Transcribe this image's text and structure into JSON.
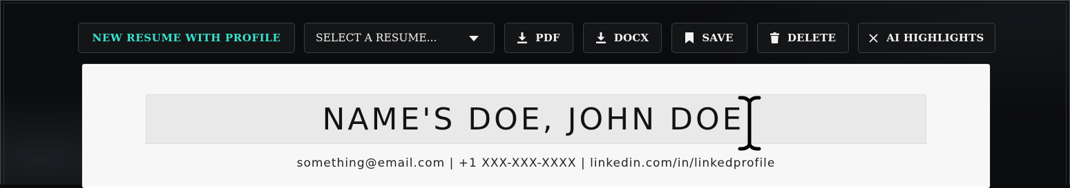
{
  "toolbar": {
    "new_resume_label": "NEW RESUME WITH PROFILE",
    "select_placeholder": "SELECT A RESUME...",
    "pdf_label": "PDF",
    "docx_label": "DOCX",
    "save_label": "SAVE",
    "delete_label": "DELETE",
    "ai_highlights_label": "AI HIGHLIGHTS"
  },
  "resume": {
    "name": "NAME'S DOE, JOHN DOE",
    "contact": "something@email.com | +1 XXX-XXX-XXXX | linkedin.com/in/linkedprofile"
  },
  "colors": {
    "accent": "#37e3cf",
    "background": "#0b0c0f",
    "button_bg": "#141517",
    "page_bg": "#f7f7f7"
  },
  "icons": {
    "pdf": "download-icon",
    "docx": "download-icon",
    "save": "bookmark-icon",
    "delete": "trash-icon",
    "ai_highlights": "close-icon",
    "select": "caret-down-icon",
    "cursor": "text-cursor-icon"
  }
}
